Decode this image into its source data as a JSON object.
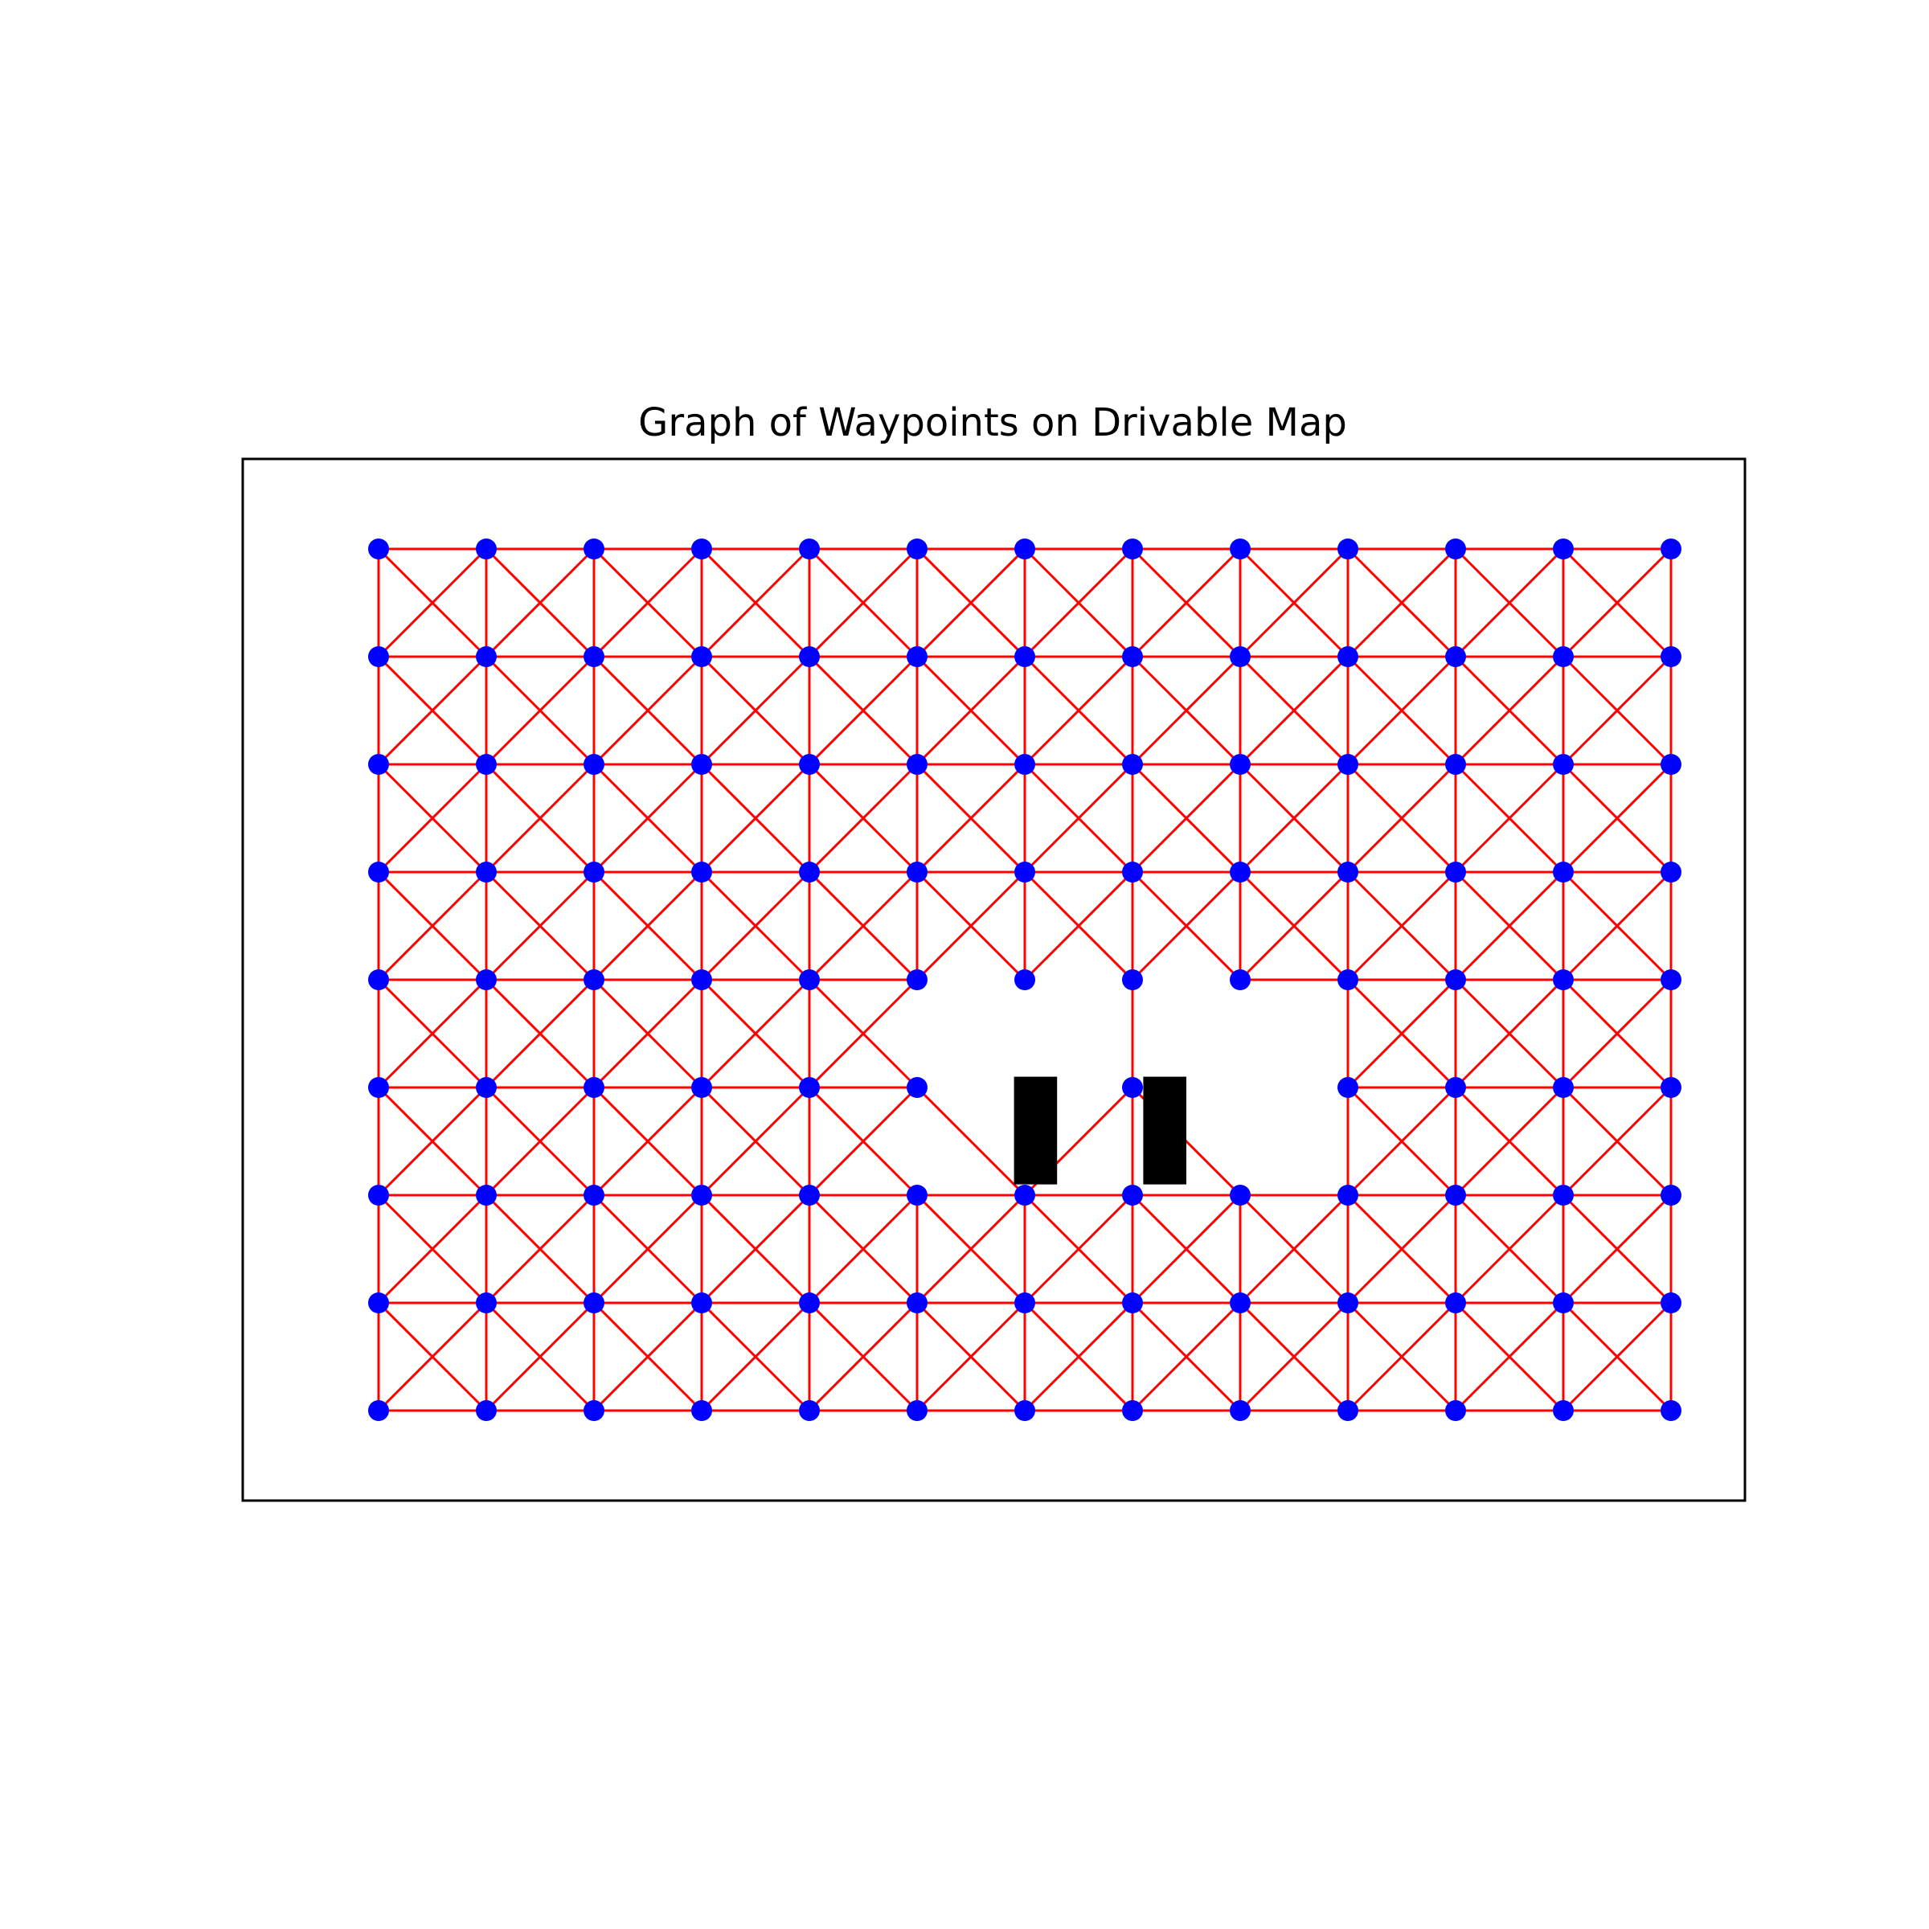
{
  "title": "Graph of Waypoints on Drivable Map",
  "colors": {
    "background": "#ffffff",
    "frame": "#000000",
    "edge": "#ff0000",
    "node": "#0000ff",
    "obstacle": "#000000"
  },
  "map": {
    "columns": 13,
    "rows": 9,
    "missing_nodes": [
      [
        5,
        6
      ],
      [
        5,
        8
      ]
    ],
    "removed_edges": [
      [
        [
          4,
          5
        ],
        [
          5,
          5
        ]
      ],
      [
        [
          5,
          5
        ],
        [
          6,
          5
        ]
      ],
      [
        [
          4,
          6
        ],
        [
          5,
          6
        ]
      ],
      [
        [
          4,
          8
        ],
        [
          5,
          8
        ]
      ],
      [
        [
          5,
          5
        ],
        [
          5,
          6
        ]
      ],
      [
        [
          5,
          7
        ],
        [
          5,
          8
        ]
      ],
      [
        [
          4,
          5
        ],
        [
          4,
          6
        ]
      ],
      [
        [
          4,
          6
        ],
        [
          4,
          7
        ]
      ],
      [
        [
          4,
          7
        ],
        [
          4,
          8
        ]
      ],
      [
        [
          5,
          5
        ],
        [
          4,
          6
        ]
      ],
      [
        [
          4,
          6
        ],
        [
          5,
          7
        ]
      ],
      [
        [
          5,
          7
        ],
        [
          4,
          8
        ]
      ],
      [
        [
          4,
          8
        ],
        [
          5,
          9
        ]
      ],
      [
        [
          5,
          9
        ],
        [
          6,
          8
        ]
      ],
      [
        [
          6,
          7
        ],
        [
          5,
          6
        ]
      ],
      [
        [
          5,
          8
        ],
        [
          6,
          9
        ]
      ]
    ],
    "obstacles": [
      {
        "name": "obstacle-left",
        "col_from": 5.9,
        "col_to": 6.3,
        "row_from": 4.9,
        "row_to": 5.9
      },
      {
        "name": "obstacle-right",
        "col_from": 7.1,
        "col_to": 7.5,
        "row_from": 4.9,
        "row_to": 5.9
      }
    ]
  }
}
